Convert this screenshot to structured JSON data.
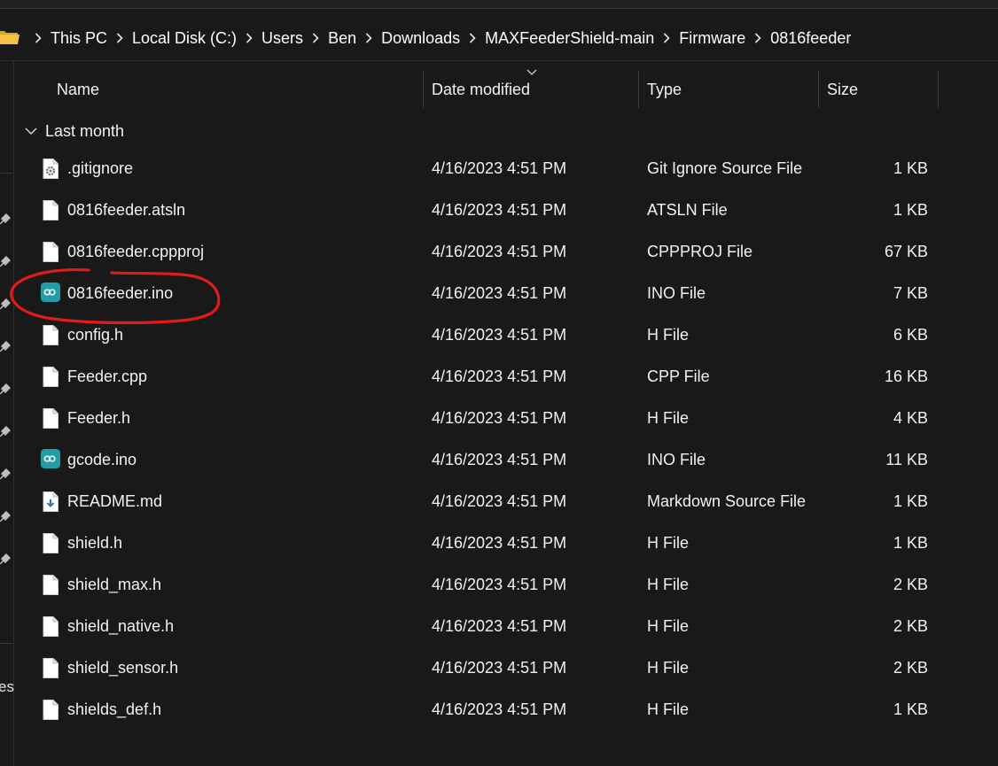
{
  "breadcrumb": [
    "This PC",
    "Local Disk (C:)",
    "Users",
    "Ben",
    "Downloads",
    "MAXFeederShield-main",
    "Firmware",
    "0816feeder"
  ],
  "columns": {
    "name": "Name",
    "date": "Date modified",
    "type": "Type",
    "size": "Size"
  },
  "group": {
    "label": "Last month"
  },
  "nav": {
    "fragment": "es"
  },
  "files": [
    {
      "name": ".gitignore",
      "date": "4/16/2023 4:51 PM",
      "type": "Git Ignore Source File",
      "size": "1 KB",
      "icon": "gear-file-icon"
    },
    {
      "name": "0816feeder.atsln",
      "date": "4/16/2023 4:51 PM",
      "type": "ATSLN File",
      "size": "1 KB",
      "icon": "file-icon"
    },
    {
      "name": "0816feeder.cppproj",
      "date": "4/16/2023 4:51 PM",
      "type": "CPPPROJ File",
      "size": "67 KB",
      "icon": "file-icon"
    },
    {
      "name": "0816feeder.ino",
      "date": "4/16/2023 4:51 PM",
      "type": "INO File",
      "size": "7 KB",
      "icon": "arduino-icon"
    },
    {
      "name": "config.h",
      "date": "4/16/2023 4:51 PM",
      "type": "H File",
      "size": "6 KB",
      "icon": "file-icon"
    },
    {
      "name": "Feeder.cpp",
      "date": "4/16/2023 4:51 PM",
      "type": "CPP File",
      "size": "16 KB",
      "icon": "file-icon"
    },
    {
      "name": "Feeder.h",
      "date": "4/16/2023 4:51 PM",
      "type": "H File",
      "size": "4 KB",
      "icon": "file-icon"
    },
    {
      "name": "gcode.ino",
      "date": "4/16/2023 4:51 PM",
      "type": "INO File",
      "size": "11 KB",
      "icon": "arduino-icon"
    },
    {
      "name": "README.md",
      "date": "4/16/2023 4:51 PM",
      "type": "Markdown Source File",
      "size": "1 KB",
      "icon": "markdown-file-icon"
    },
    {
      "name": "shield.h",
      "date": "4/16/2023 4:51 PM",
      "type": "H File",
      "size": "1 KB",
      "icon": "file-icon"
    },
    {
      "name": "shield_max.h",
      "date": "4/16/2023 4:51 PM",
      "type": "H File",
      "size": "2 KB",
      "icon": "file-icon"
    },
    {
      "name": "shield_native.h",
      "date": "4/16/2023 4:51 PM",
      "type": "H File",
      "size": "2 KB",
      "icon": "file-icon"
    },
    {
      "name": "shield_sensor.h",
      "date": "4/16/2023 4:51 PM",
      "type": "H File",
      "size": "2 KB",
      "icon": "file-icon"
    },
    {
      "name": "shields_def.h",
      "date": "4/16/2023 4:51 PM",
      "type": "H File",
      "size": "1 KB",
      "icon": "file-icon"
    }
  ],
  "annotation": {
    "target": "0816feeder.ino",
    "color": "#e01b1b"
  },
  "colors": {
    "background": "#191919",
    "text": "#ffffff",
    "folder": "#f5c342",
    "arduino": "#1f9ea6"
  }
}
